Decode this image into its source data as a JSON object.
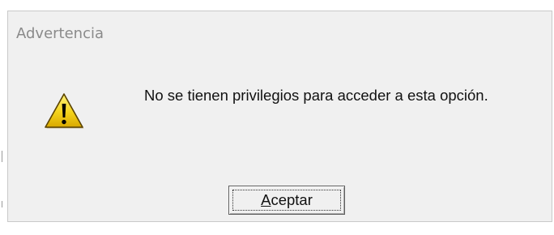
{
  "dialog": {
    "title": "Advertencia",
    "icon": "warning-icon",
    "message": "No se tienen privilegios para acceder a esta opción.",
    "ok_button": {
      "mnemonic": "A",
      "rest": "ceptar"
    }
  },
  "colors": {
    "dialog_background": "#f0f0f0",
    "title_text": "#8a8a8a",
    "warning_yellow": "#f4d31c"
  }
}
